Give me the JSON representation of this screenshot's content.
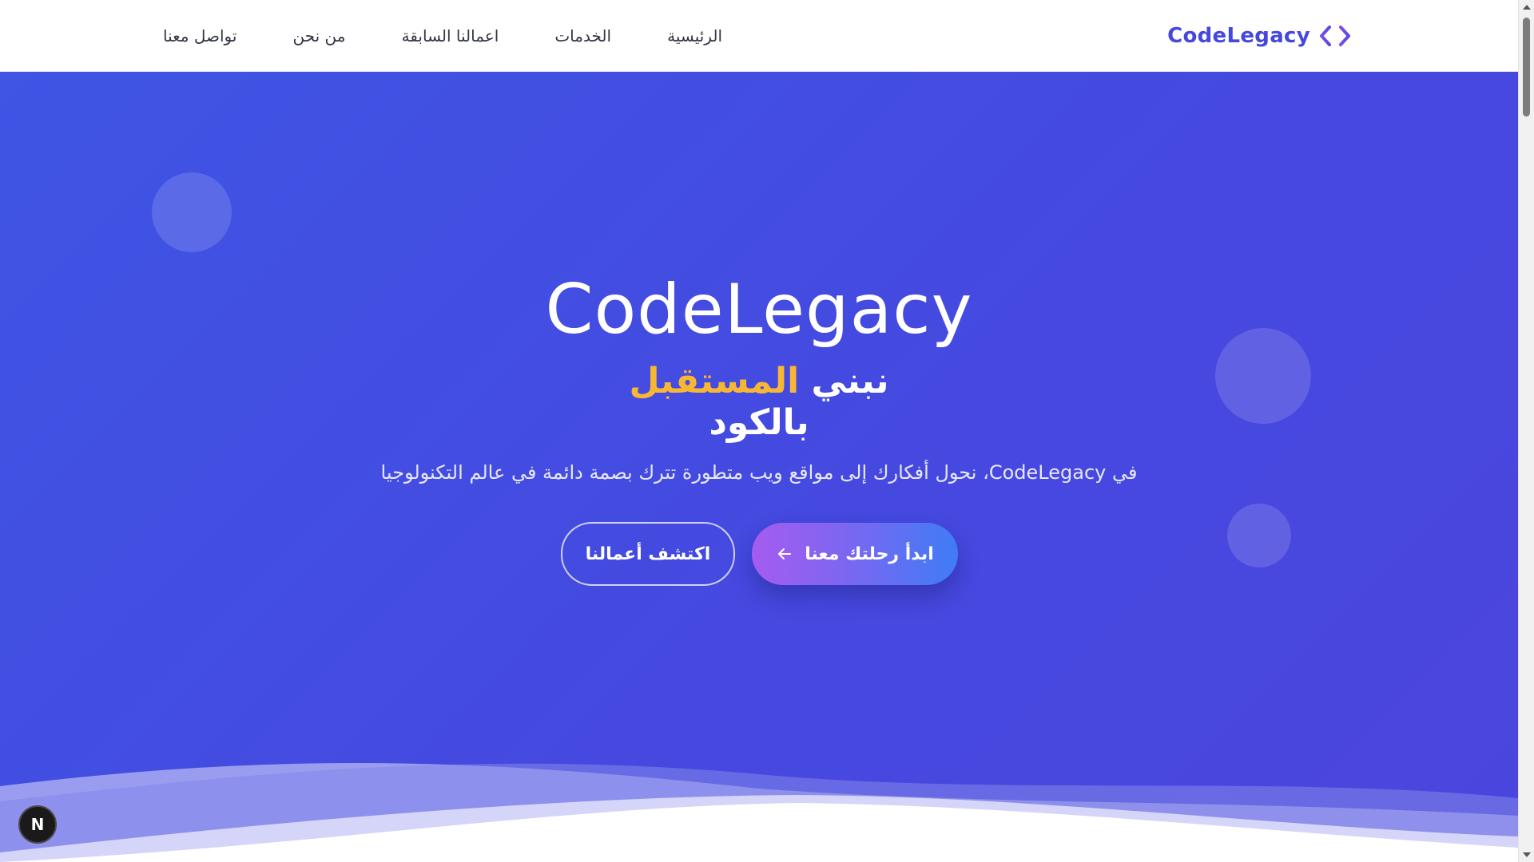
{
  "navbar": {
    "brand": {
      "name": "CodeLegacy",
      "icon": "code-brackets-icon"
    },
    "links": [
      {
        "label": "الرئيسية"
      },
      {
        "label": "الخدمات"
      },
      {
        "label": "اعمالنا السابقة"
      },
      {
        "label": "من نحن"
      },
      {
        "label": "تواصل معنا"
      }
    ]
  },
  "hero": {
    "title": "CodeLegacy",
    "subtitle": {
      "prefix": "نبني",
      "accent": "المستقبل",
      "suffix": "بالكود"
    },
    "description": "في CodeLegacy، نحول أفكارك إلى مواقع ويب متطورة تترك بصمة دائمة في عالم التكنولوجيا",
    "primary_button": {
      "label": "ابدأ رحلتك معنا",
      "icon": "arrow-left-icon"
    },
    "secondary_button": {
      "label": "اكتشف أعمالنا"
    }
  },
  "dev_badge": {
    "label": "N",
    "icon": "nextjs-icon"
  },
  "colors": {
    "brand": "#4547dd",
    "hero_background": "#4549e0",
    "accent": "#f7b733",
    "primary_gradient_start": "#3f7cf6",
    "primary_gradient_end": "#a55cf0",
    "nav_text": "#333744"
  }
}
